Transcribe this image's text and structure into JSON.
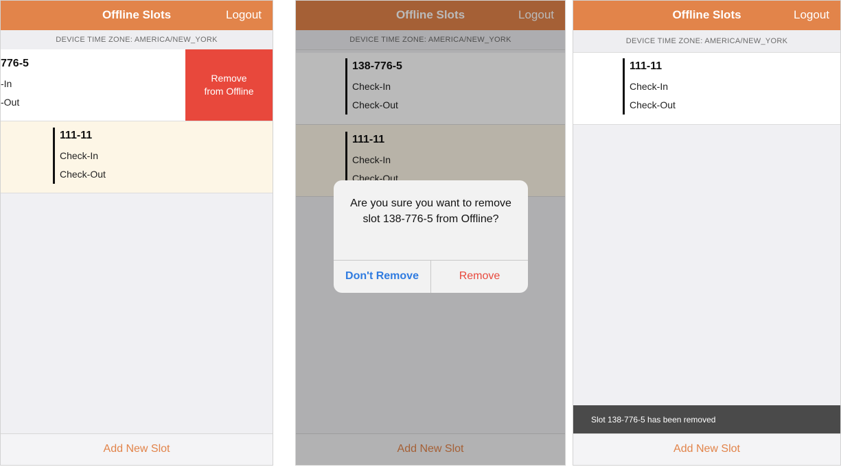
{
  "header": {
    "title": "Offline Slots",
    "logout_label": "Logout"
  },
  "timezone_label": "DEVICE TIME ZONE: AMERICA/NEW_YORK",
  "slot_a": {
    "id": "138-776-5",
    "check_in": "Check-In",
    "check_out": "Check-Out"
  },
  "slot_b": {
    "id": "111-11",
    "check_in": "Check-In",
    "check_out": "Check-Out"
  },
  "panel1": {
    "slot_a_visible": {
      "id": "776-5",
      "check_in": "-In",
      "check_out": "-Out"
    },
    "swipe_action": {
      "line1": "Remove",
      "line2": "from Offline"
    }
  },
  "panel2": {
    "slot_b_partial_check_out": "Check-Out",
    "alert": {
      "message": "Are you sure you want to remove slot 138-776-5 from Offline?",
      "cancel_label": "Don't Remove",
      "confirm_label": "Remove"
    }
  },
  "toast": {
    "message": "Slot 138-776-5 has been removed"
  },
  "footer": {
    "add_label": "Add New Slot"
  },
  "colors": {
    "brand": "#e2844a",
    "destructive": "#e8483c",
    "link_blue": "#2f7be0",
    "highlight_row": "#fdf6e6"
  }
}
